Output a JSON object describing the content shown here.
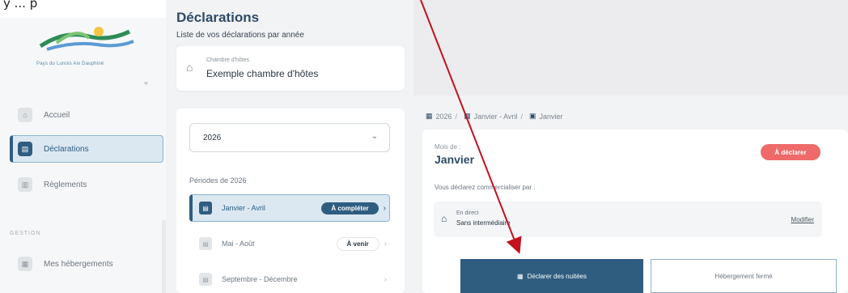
{
  "top_note": "y ... p",
  "sidebar": {
    "logo_caption": "Pays du Lunois Aix Dauphiné",
    "collapse_label": "«",
    "items": [
      {
        "label": "Accueil",
        "icon": "home-icon"
      },
      {
        "label": "Déclarations",
        "icon": "document-icon",
        "active": true
      },
      {
        "label": "Règlements",
        "icon": "payment-icon"
      }
    ],
    "section_label": "GESTION",
    "gestion_items": [
      {
        "label": "Mes hébergements",
        "icon": "building-icon"
      }
    ]
  },
  "header": {
    "title": "Déclarations",
    "subtitle": "Liste de vos déclarations par année"
  },
  "property": {
    "category": "Chambre d'hôtes",
    "name": "Exemple chambre d'hôtes"
  },
  "year_select": {
    "value": "2026"
  },
  "periods": {
    "title": "Périodes de 2026",
    "items": [
      {
        "label": "Janvier - Avril",
        "badge": "À compléter",
        "active": true
      },
      {
        "label": "Mai - Août",
        "badge": "À venir"
      },
      {
        "label": "Septembre - Décembre",
        "badge": ""
      }
    ]
  },
  "breadcrumb": {
    "items": [
      "2026",
      "Janvier - Avril",
      "Janvier"
    ]
  },
  "month_detail": {
    "month_label": "Mois de :",
    "month_value": "Janvier",
    "status": "À déclarer",
    "commercialize_label": "Vous déclarez commercialiser par :",
    "channel_line1": "En direct",
    "channel_line2": "Sans intermédiaire",
    "modify_label": "Modifier",
    "declare_button": "Déclarer des nuitées",
    "closed_button": "Hébergement fermé"
  },
  "colors": {
    "brand": "#2f5d80",
    "danger": "#ef6a6a",
    "annotation_arrow": "#c1121f"
  }
}
